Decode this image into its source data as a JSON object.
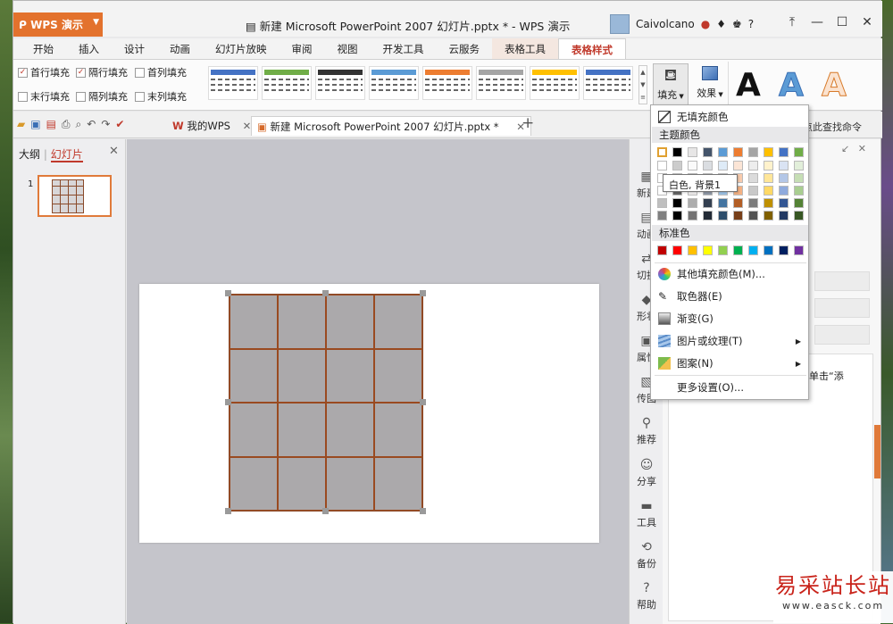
{
  "app": {
    "name": "WPS 演示",
    "title": "新建 Microsoft PowerPoint 2007 幻灯片.pptx * - WPS 演示",
    "user": "Caivolcano",
    "help": "?"
  },
  "ribbon_tabs": [
    {
      "label": "开始"
    },
    {
      "label": "插入"
    },
    {
      "label": "设计"
    },
    {
      "label": "动画"
    },
    {
      "label": "幻灯片放映"
    },
    {
      "label": "审阅"
    },
    {
      "label": "视图"
    },
    {
      "label": "开发工具"
    },
    {
      "label": "云服务"
    },
    {
      "label": "表格工具"
    },
    {
      "label": "表格样式"
    }
  ],
  "ribbon": {
    "options": [
      {
        "label": "首行填充",
        "checked": true
      },
      {
        "label": "隔行填充",
        "checked": true
      },
      {
        "label": "首列填充",
        "checked": false
      },
      {
        "label": "末行填充",
        "checked": false
      },
      {
        "label": "隔列填充",
        "checked": false
      },
      {
        "label": "末列填充",
        "checked": false
      }
    ],
    "table_style_colors": [
      "#4472c4",
      "#70ad47",
      "#333333",
      "#5b9bd5",
      "#ed7d31",
      "#a5a5a5",
      "#ffc000",
      "#4472c4"
    ],
    "fill_label": "填充",
    "effect_label": "效果",
    "wordart_letter": "A",
    "wordart_colors": [
      "#111111",
      "#5b9bd5",
      "#f4b183"
    ]
  },
  "doc_tabs": [
    {
      "label": "我的WPS"
    },
    {
      "label": "新建 Microsoft PowerPoint 2007 幻灯片.pptx *"
    }
  ],
  "left_pane": {
    "tab_outline": "大纲",
    "tab_slides": "幻灯片",
    "slide_number": "1"
  },
  "right_sidebar": [
    {
      "label": "新建"
    },
    {
      "label": "动画"
    },
    {
      "label": "切换"
    },
    {
      "label": "形状"
    },
    {
      "label": "属性"
    },
    {
      "label": "传图"
    },
    {
      "label": "推荐"
    },
    {
      "label": "分享"
    },
    {
      "label": "工具"
    },
    {
      "label": "备份"
    },
    {
      "label": "帮助"
    }
  ],
  "task_pane": {
    "hint_fragment": "点此查找命令",
    "text_fragment": "后单击“添"
  },
  "fill_menu": {
    "no_fill": "无填充颜色",
    "theme_colors_label": "主题颜色",
    "theme_colors": [
      "#ffffff",
      "#000000",
      "#e7e6e6",
      "#44546a",
      "#5b9bd5",
      "#ed7d31",
      "#a5a5a5",
      "#ffc000",
      "#4472c4",
      "#70ad47"
    ],
    "tooltip": "白色, 背景1",
    "standard_colors_label": "标准色",
    "standard_colors": [
      "#c00000",
      "#ff0000",
      "#ffc000",
      "#ffff00",
      "#92d050",
      "#00b050",
      "#00b0f0",
      "#0070c0",
      "#002060",
      "#7030a0"
    ],
    "items": [
      {
        "label": "其他填充颜色(M)..."
      },
      {
        "label": "取色器(E)"
      },
      {
        "label": "渐变(G)"
      },
      {
        "label": "图片或纹理(T)"
      },
      {
        "label": "图案(N)"
      },
      {
        "label": "更多设置(O)..."
      }
    ]
  },
  "watermark": {
    "title": "易采站长站",
    "url": "www.easck.com"
  }
}
